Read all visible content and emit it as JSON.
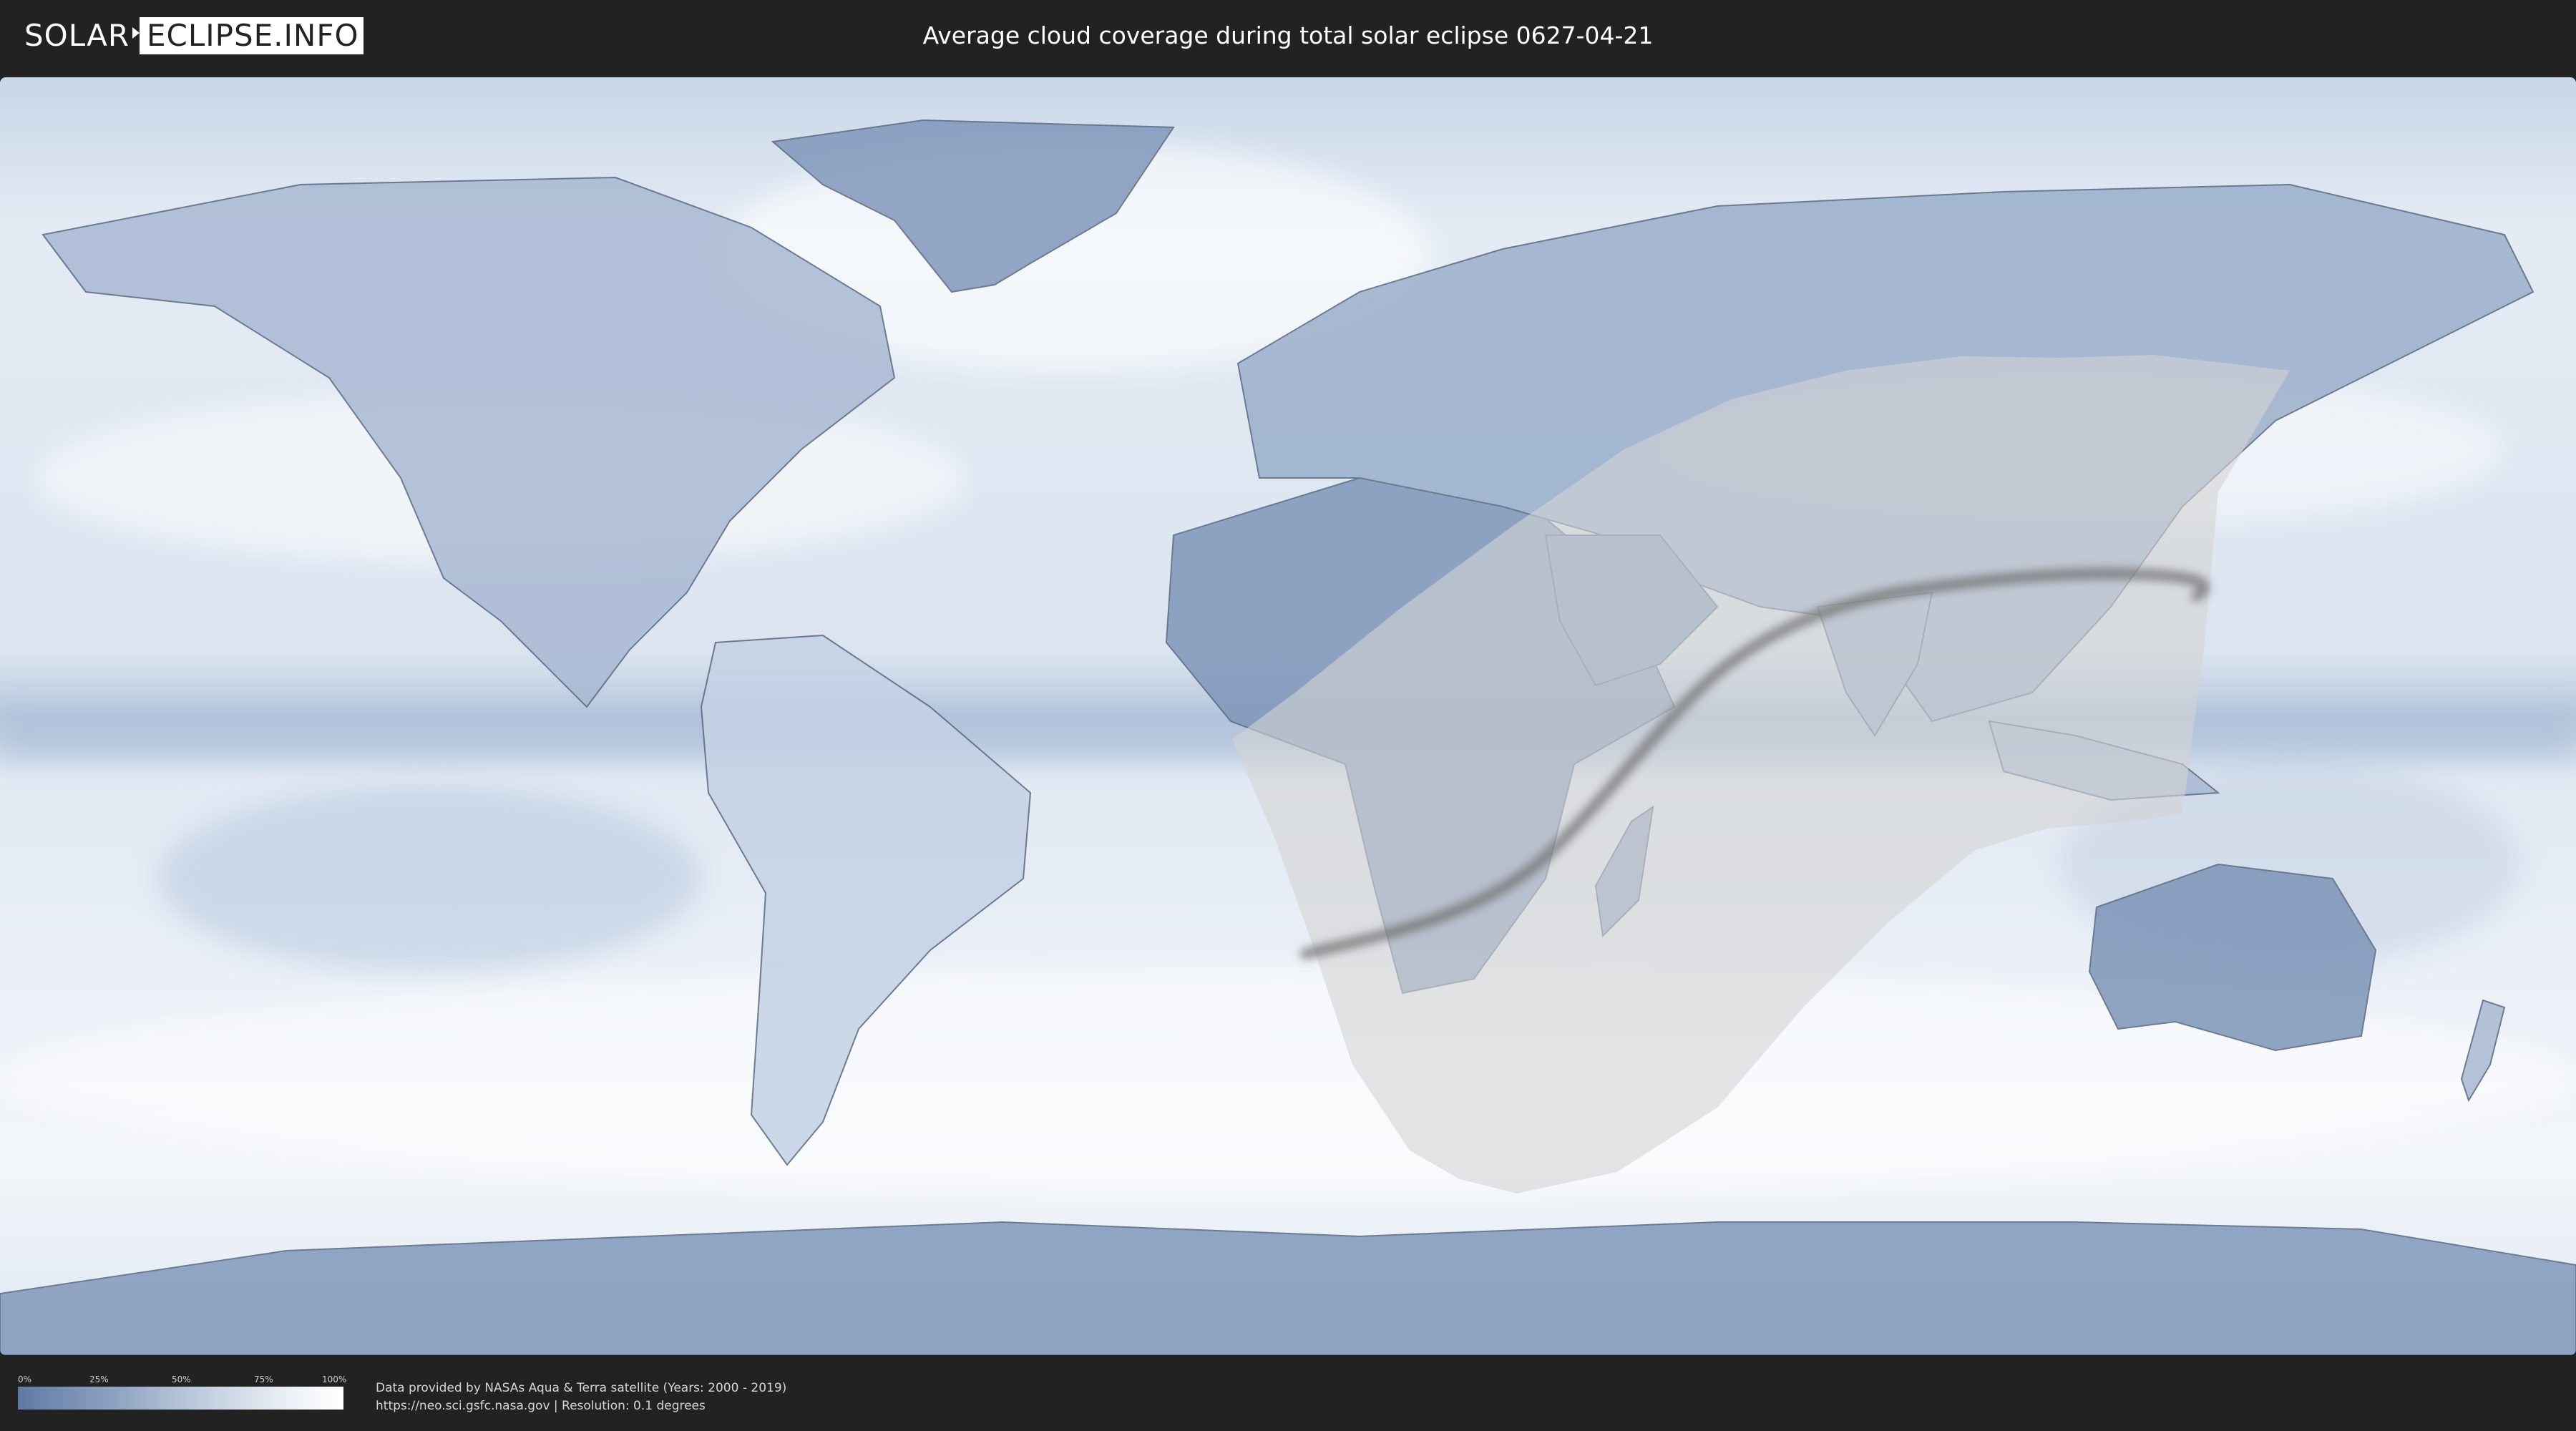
{
  "header": {
    "logo_left": "SOLAR",
    "logo_right": "ECLIPSE.INFO",
    "title": "Average cloud coverage during total solar eclipse 0627-04-21"
  },
  "legend": {
    "ticks": [
      "0%",
      "25%",
      "50%",
      "75%",
      "100%"
    ],
    "colors": {
      "low": "#5f7aa3",
      "high": "#ffffff"
    }
  },
  "footer": {
    "line1": "Data provided by NASAs Aqua & Terra satellite (Years: 2000 - 2019)",
    "line2": "https://neo.sci.gsfc.nasa.gov | Resolution: 0.1 degrees"
  },
  "colors": {
    "background": "#222222",
    "ocean_cloud": "#e6edf6",
    "land_clear": "#7d94b8",
    "eclipse_zone": "#d3d3d3",
    "totality_path": "#6b6b6b"
  }
}
